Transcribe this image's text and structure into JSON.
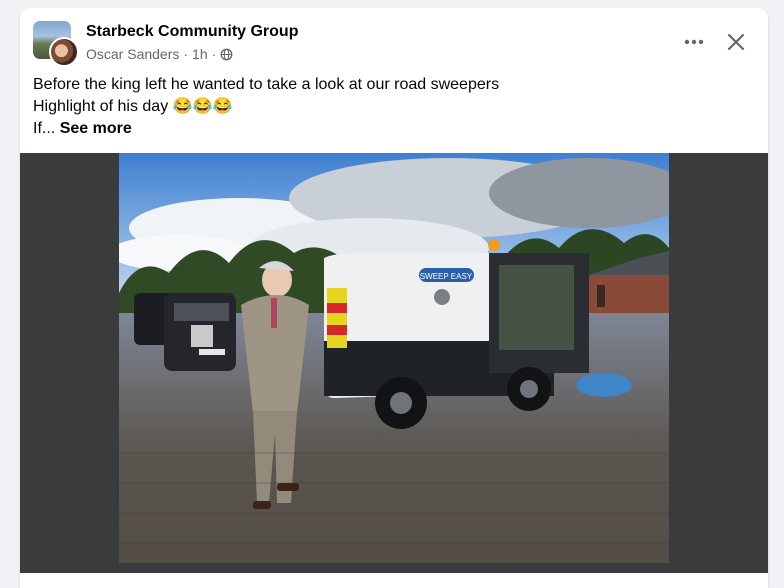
{
  "post": {
    "group_name": "Starbeck Community Group",
    "author": "Oscar Sanders",
    "separator": "·",
    "time": "1h",
    "privacy_icon": "globe-icon",
    "text_line1": "Before the king left he wanted to take a look at our road sweepers",
    "text_line2": "Highlight of his day 😂😂😂",
    "text_line3_start": "If...",
    "see_more": "See more",
    "more_icon": "more-horizontal-icon",
    "close_icon": "close-icon"
  },
  "photo": {
    "sweeper_brand": "SWEEP EASY"
  },
  "colors": {
    "text_primary": "#050505",
    "text_secondary": "#65676b",
    "media_bg": "#3a3b3c"
  }
}
